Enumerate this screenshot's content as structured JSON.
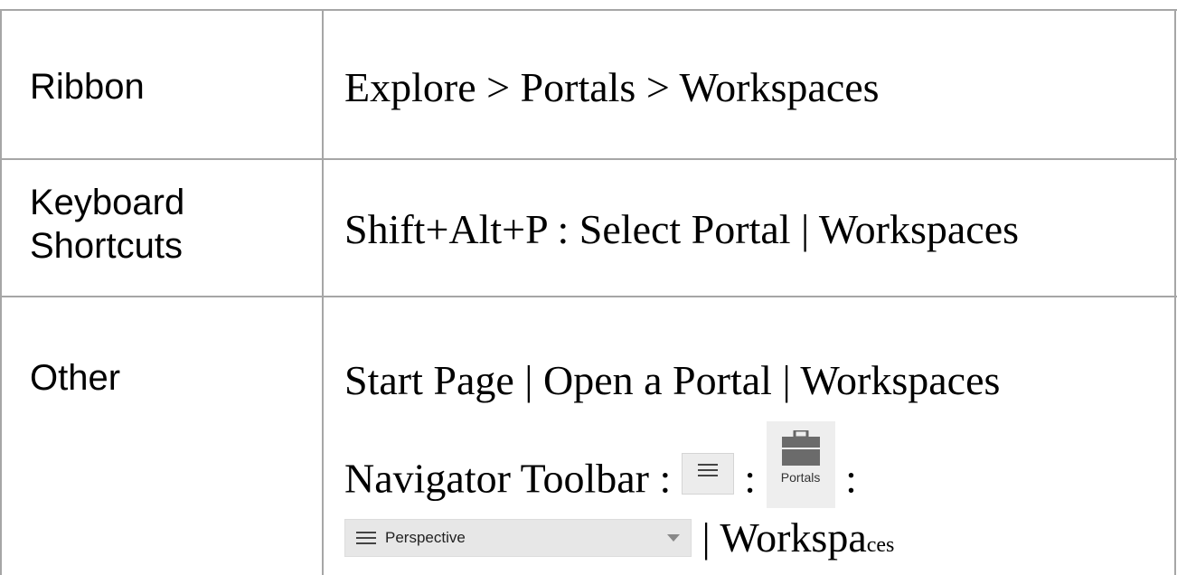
{
  "rows": [
    {
      "label": "Ribbon",
      "value": "Explore > Portals > Workspaces"
    },
    {
      "label_line1": "Keyboard",
      "label_line2": "Shortcuts",
      "value": "Shift+Alt+P : Select Portal | Workspaces"
    },
    {
      "label": "Other",
      "value_line1": "Start Page | Open a Portal | Workspaces",
      "nav_prefix": "Navigator Toolbar :",
      "sep": ":",
      "portals_label": "Portals",
      "perspective_label": "Perspective",
      "tail_main": "| Workspa",
      "tail_small": "ces"
    }
  ],
  "icons": {
    "menu": "hamburger-menu-icon",
    "portals": "briefcase-icon",
    "perspective_menu": "hamburger-menu-icon",
    "dropdown": "chevron-down-icon"
  },
  "colors": {
    "grid": "#a6a6a6",
    "text": "#000000",
    "button_bg": "#ececec"
  }
}
